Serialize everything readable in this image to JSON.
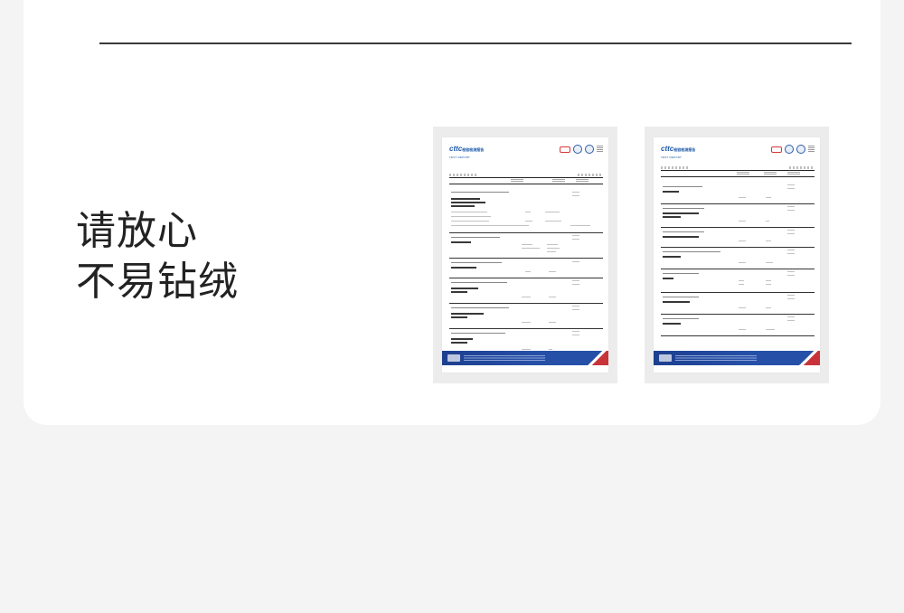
{
  "headline": {
    "line1": "请放心",
    "line2": "不易钻绒"
  },
  "reports": [
    {
      "logo": "cttc",
      "title": "检验检测报告",
      "subtitle": "TEST REPORT"
    },
    {
      "logo": "cttc",
      "title": "检验检测报告",
      "subtitle": "TEST REPORT"
    }
  ],
  "colors": {
    "page_bg": "#f4f4f4",
    "card_bg": "#ffffff",
    "rule": "#3a3a3a",
    "report_blue": "#1d3f8f",
    "badge_red": "#d63838"
  }
}
